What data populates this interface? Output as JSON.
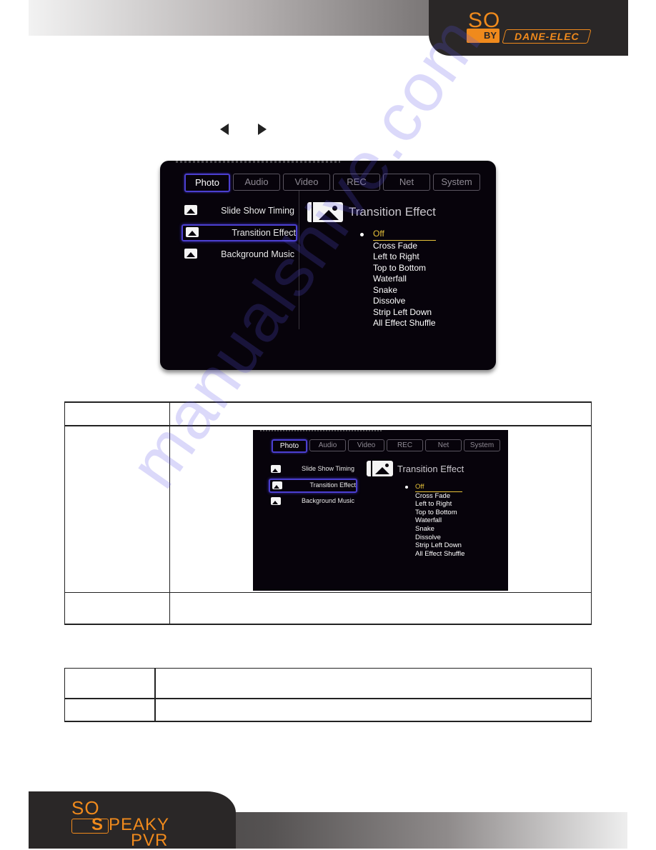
{
  "header": {
    "logo_so": "SO",
    "logo_by": "BY",
    "logo_brand": "DANE-ELEC"
  },
  "nav_arrows": [
    "left-arrow",
    "right-arrow"
  ],
  "tv_menu": {
    "tabs": [
      {
        "label": "Photo",
        "active": true
      },
      {
        "label": "Audio",
        "active": false
      },
      {
        "label": "Video",
        "active": false
      },
      {
        "label": "REC",
        "active": false
      },
      {
        "label": "Net",
        "active": false
      },
      {
        "label": "System",
        "active": false
      }
    ],
    "sidebar": [
      {
        "label": "Slide Show Timing",
        "icon": "photo-timer-icon",
        "selected": false
      },
      {
        "label": "Transition Effect",
        "icon": "photo-transition-icon",
        "selected": true
      },
      {
        "label": "Background Music",
        "icon": "photo-music-icon",
        "selected": false
      }
    ],
    "panel_title": "Transition Effect",
    "panel_icon": "photo-transition-icon",
    "options": [
      {
        "label": "Off",
        "selected": true
      },
      {
        "label": "Cross Fade",
        "selected": false
      },
      {
        "label": "Left to Right",
        "selected": false
      },
      {
        "label": "Top to Bottom",
        "selected": false
      },
      {
        "label": "Waterfall",
        "selected": false
      },
      {
        "label": "Snake",
        "selected": false
      },
      {
        "label": "Dissolve",
        "selected": false
      },
      {
        "label": "Strip Left Down",
        "selected": false
      },
      {
        "label": "All Effect Shuffle",
        "selected": false
      }
    ],
    "accent_color": "#4b3fd0",
    "selected_option_color": "#e8c33a"
  },
  "footer": {
    "logo_so": "SO",
    "logo_s": "S",
    "logo_peaky": "PEAKY",
    "logo_pvr": "PVR",
    "brand_color": "#f08a1c"
  },
  "watermark": "manualshive.com"
}
